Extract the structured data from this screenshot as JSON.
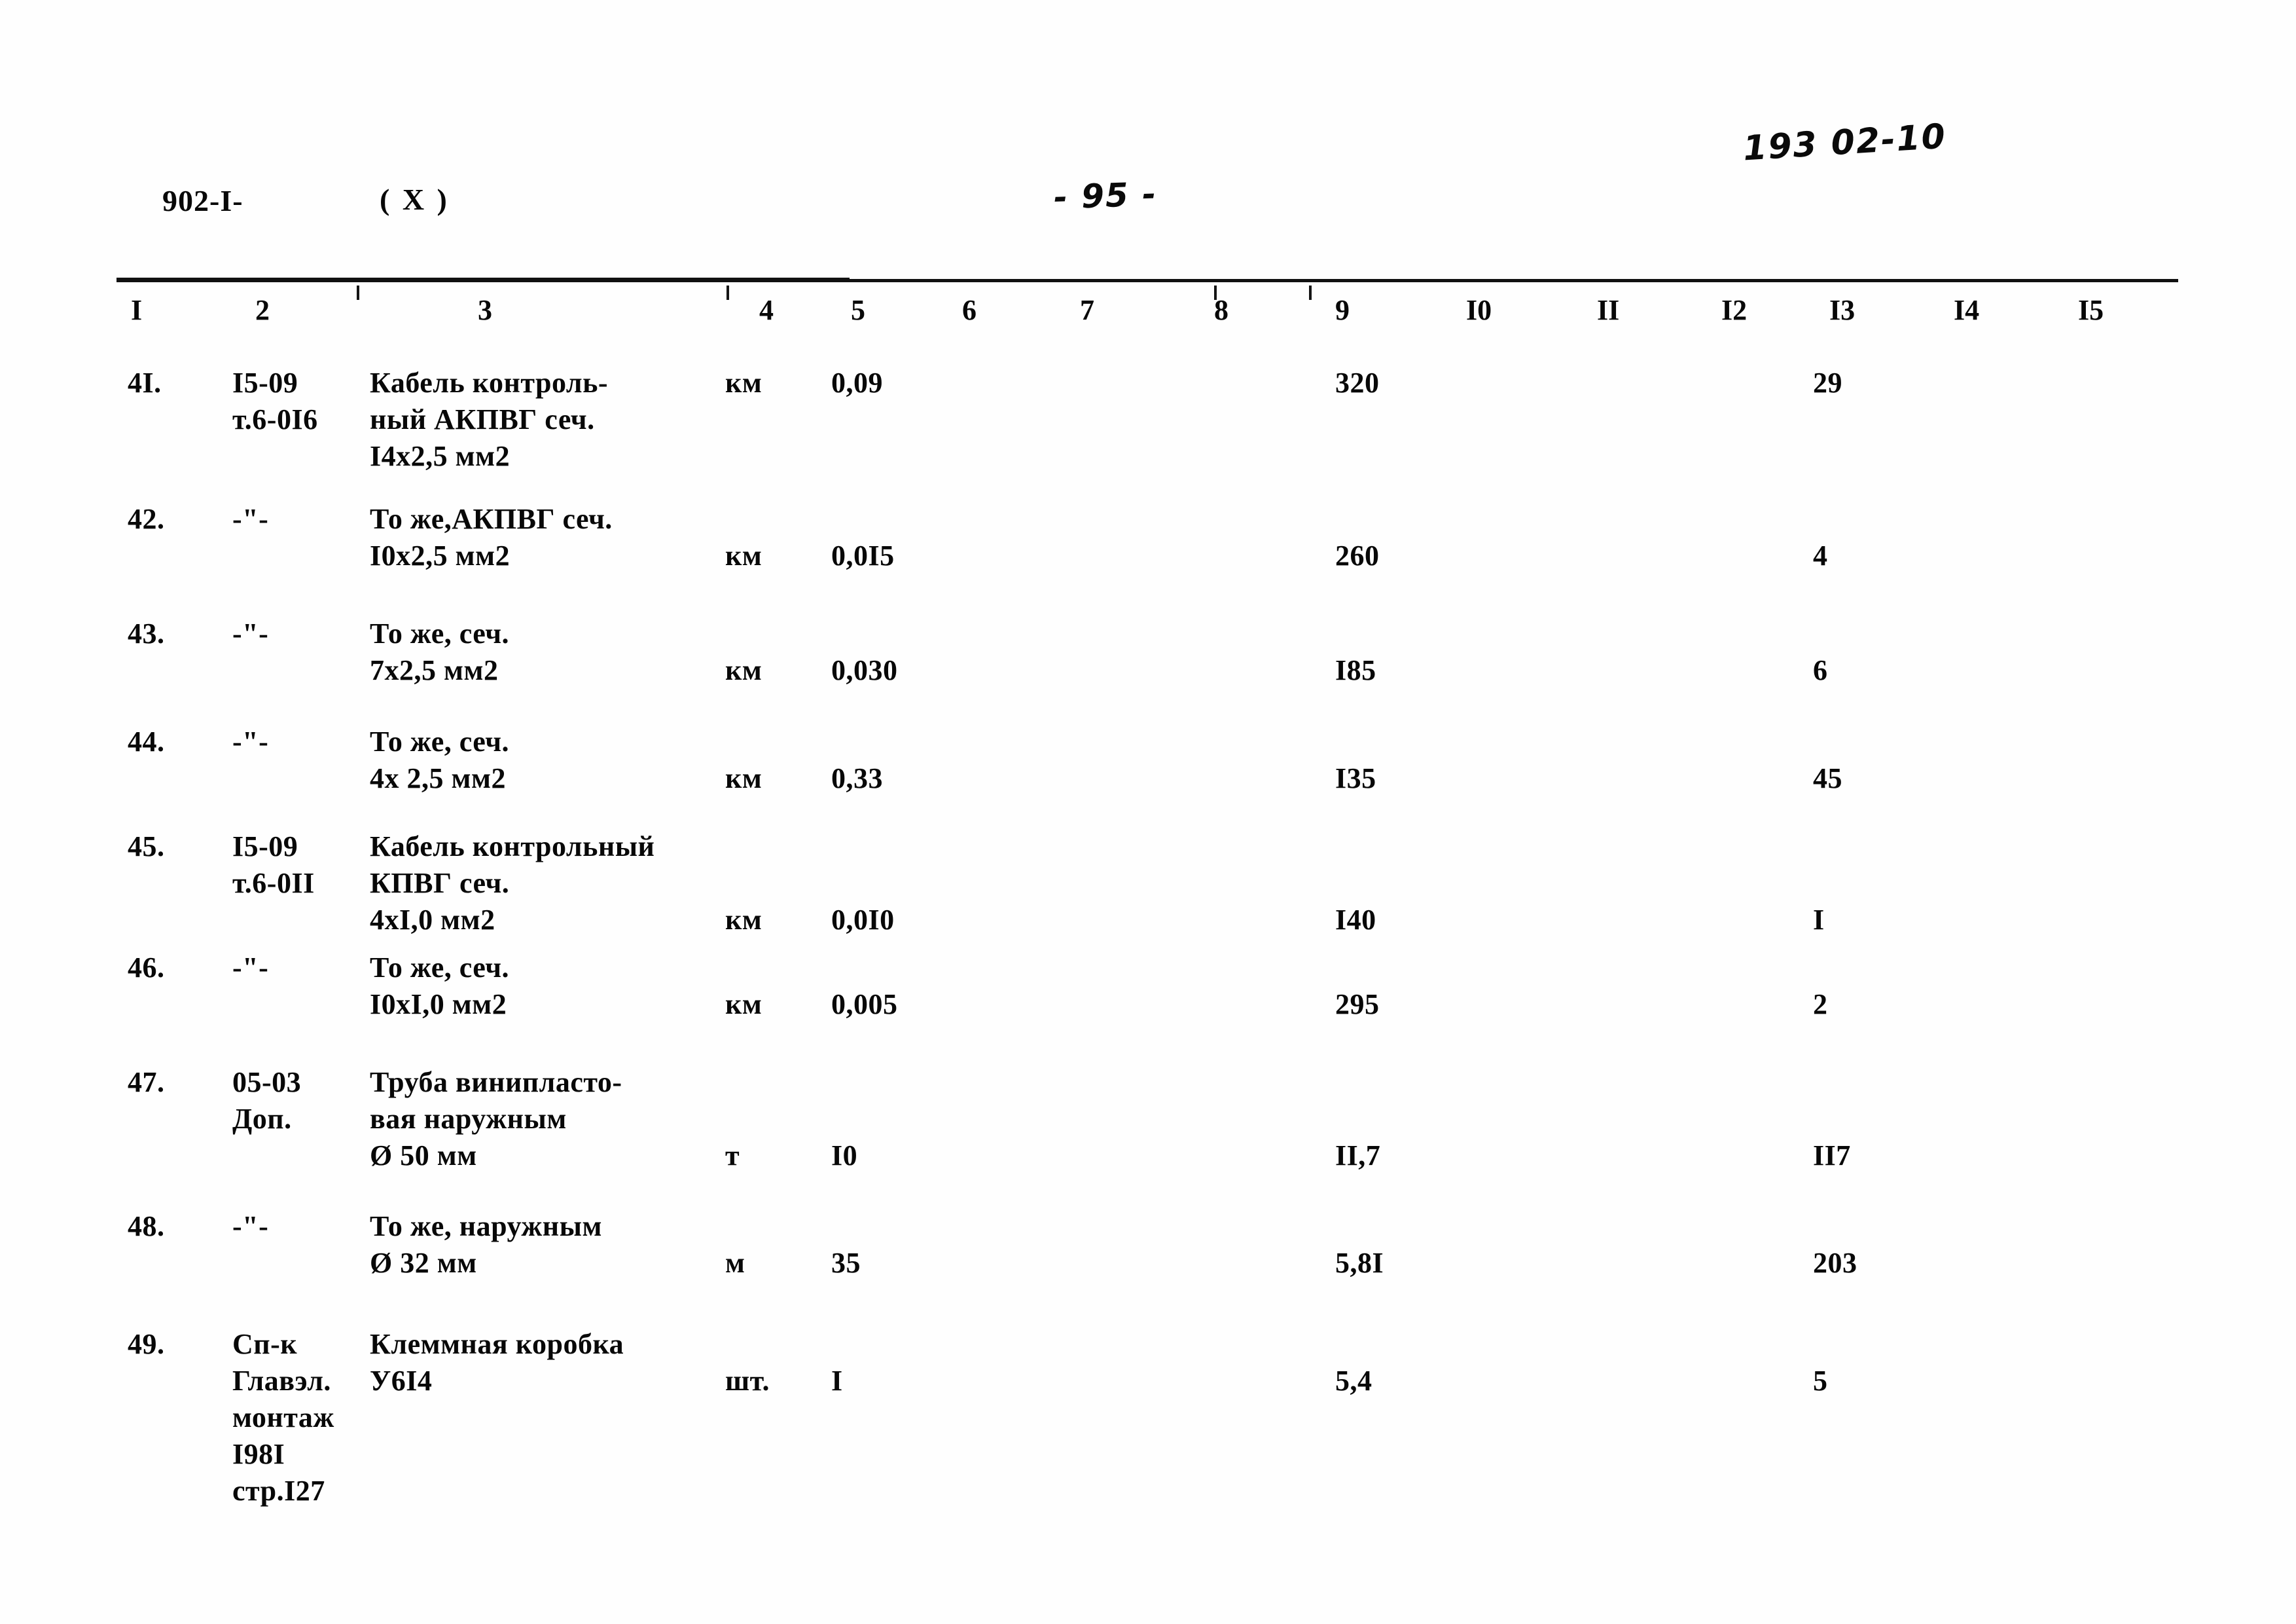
{
  "header": {
    "doc_code": "902-I-",
    "doc_variant": "( X )",
    "page_marker": "- 95 -",
    "hand_code": "193 02-10"
  },
  "table": {
    "column_headers": [
      "I",
      "2",
      "3",
      "4",
      "5",
      "6",
      "7",
      "8",
      "9",
      "I0",
      "II",
      "I2",
      "I3",
      "I4",
      "I5"
    ],
    "rows": [
      {
        "num": "4I.",
        "code_lines": [
          "I5-09",
          "т.6-0I6"
        ],
        "name_lines": [
          "Кабель контроль-",
          "ный АКПВГ сеч.",
          "I4х2,5 мм2"
        ],
        "unit": "км",
        "qty": "0,09",
        "price": "320",
        "total": "29"
      },
      {
        "num": "42.",
        "code_lines": [
          "-\"-"
        ],
        "name_lines": [
          "То же,АКПВГ сеч.",
          "I0х2,5 мм2"
        ],
        "unit": "км",
        "qty": "0,0I5",
        "price": "260",
        "total": "4"
      },
      {
        "num": "43.",
        "code_lines": [
          "-\"-"
        ],
        "name_lines": [
          "То же, сеч.",
          "7х2,5 мм2"
        ],
        "unit": "км",
        "qty": "0,030",
        "price": "I85",
        "total": "6"
      },
      {
        "num": "44.",
        "code_lines": [
          "-\"-"
        ],
        "name_lines": [
          "То же, сеч.",
          "4х 2,5 мм2"
        ],
        "unit": "км",
        "qty": "0,33",
        "price": "I35",
        "total": "45"
      },
      {
        "num": "45.",
        "code_lines": [
          "I5-09",
          "т.6-0II"
        ],
        "name_lines": [
          "Кабель контрольный",
          "КПВГ сеч.",
          "4хI,0 мм2"
        ],
        "unit": "км",
        "qty": "0,0I0",
        "price": "I40",
        "total": "I"
      },
      {
        "num": "46.",
        "code_lines": [
          "-\"-"
        ],
        "name_lines": [
          "То же, сеч.",
          "I0хI,0 мм2"
        ],
        "unit": "км",
        "qty": "0,005",
        "price": "295",
        "total": "2"
      },
      {
        "num": "47.",
        "code_lines": [
          "05-03",
          "Доп."
        ],
        "name_lines": [
          "Труба винипласто-",
          "вая наружным",
          "Ø 50 мм"
        ],
        "unit": "т",
        "qty": "I0",
        "price": "II,7",
        "total": "II7"
      },
      {
        "num": "48.",
        "code_lines": [
          "-\"-"
        ],
        "name_lines": [
          "То же, наружным",
          "Ø 32 мм"
        ],
        "unit": "м",
        "qty": "35",
        "price": "5,8I",
        "total": "203"
      },
      {
        "num": "49.",
        "code_lines": [
          "Сп-к",
          "Главэл.",
          "монтаж",
          "I98I",
          "стр.I27"
        ],
        "name_lines": [
          "Клеммная коробка",
          "У6I4"
        ],
        "unit": "шт.",
        "qty": "I",
        "price": "5,4",
        "total": "5"
      }
    ]
  },
  "layout": {
    "columns_x": {
      "num": 195,
      "code": 355,
      "name": 565,
      "unit": 1108,
      "qty": 1270,
      "price": 2040,
      "total": 2770
    },
    "header_x": [
      200,
      390,
      730,
      1160,
      1300,
      1470,
      1650,
      1855,
      2040,
      2240,
      2440,
      2630,
      2795,
      2985,
      3175
    ],
    "tick_x": [
      545,
      1110,
      1855,
      2000
    ],
    "row_tops": [
      557,
      765,
      940,
      1105,
      1265,
      1450,
      1625,
      1845,
      2025
    ],
    "row_value_offsets": [
      0,
      56,
      56,
      56,
      112,
      56,
      112,
      56,
      56
    ]
  }
}
